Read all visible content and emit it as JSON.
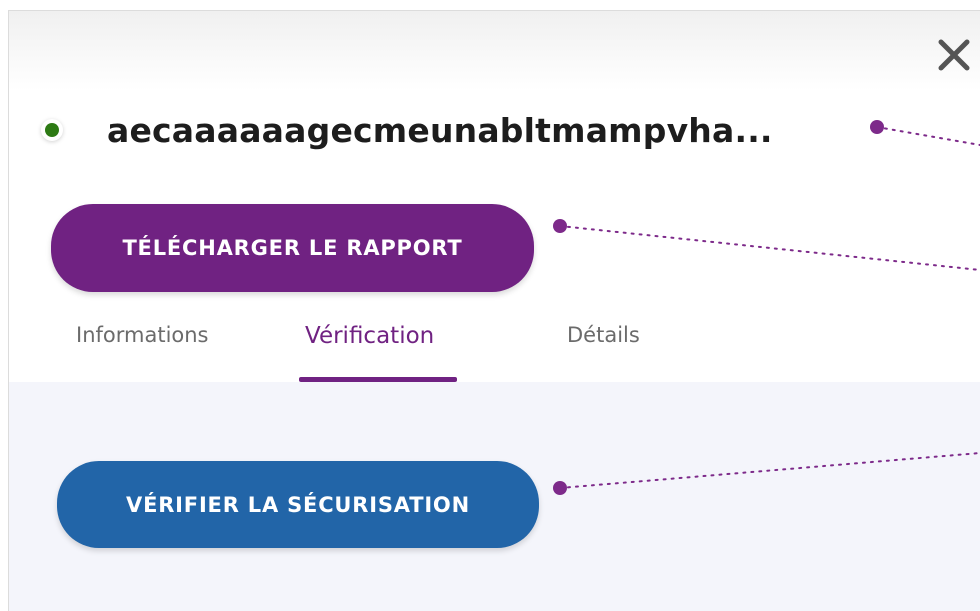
{
  "header": {
    "close_icon": "close-icon",
    "status_color": "#2d7a14",
    "title": "aecaaaaaagecmeunabltmampvha..."
  },
  "actions": {
    "download_label": "TÉLÉCHARGER LE RAPPORT",
    "verify_label": "VÉRIFIER LA SÉCURISATION"
  },
  "tabs": [
    {
      "label": "Informations",
      "active": false
    },
    {
      "label": "Vérification",
      "active": true
    },
    {
      "label": "Détails",
      "active": false
    }
  ],
  "colors": {
    "primary_purple": "#702282",
    "verify_blue": "#2265a8",
    "callout": "#7d2a8a"
  }
}
